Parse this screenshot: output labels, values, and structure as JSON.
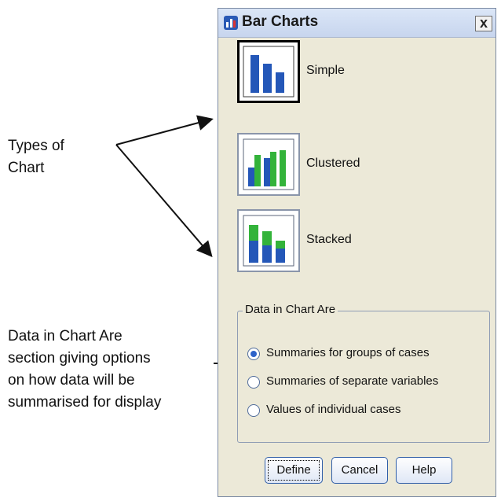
{
  "annotations": {
    "types_of_chart": "Types of\nChart",
    "data_in_chart": "Data in Chart Are\nsection giving options\non how data will be\nsummarised for display"
  },
  "dialog": {
    "title": "Bar Charts",
    "close_glyph": "x",
    "chart_types": [
      {
        "label": "Simple",
        "selected": true,
        "icon": "simple-bar-chart-icon"
      },
      {
        "label": "Clustered",
        "selected": false,
        "icon": "clustered-bar-chart-icon"
      },
      {
        "label": "Stacked",
        "selected": false,
        "icon": "stacked-bar-chart-icon"
      }
    ],
    "group": {
      "legend": "Data in Chart Are",
      "options": [
        {
          "label": "Summaries for groups of cases",
          "checked": true
        },
        {
          "label": "Summaries of separate variables",
          "checked": false
        },
        {
          "label": "Values of individual cases",
          "checked": false
        }
      ]
    },
    "buttons": {
      "define": "Define",
      "cancel": "Cancel",
      "help": "Help"
    }
  },
  "colors": {
    "bar_blue": "#2457b8",
    "bar_green": "#33b33a",
    "accent": "#2d62c9"
  }
}
